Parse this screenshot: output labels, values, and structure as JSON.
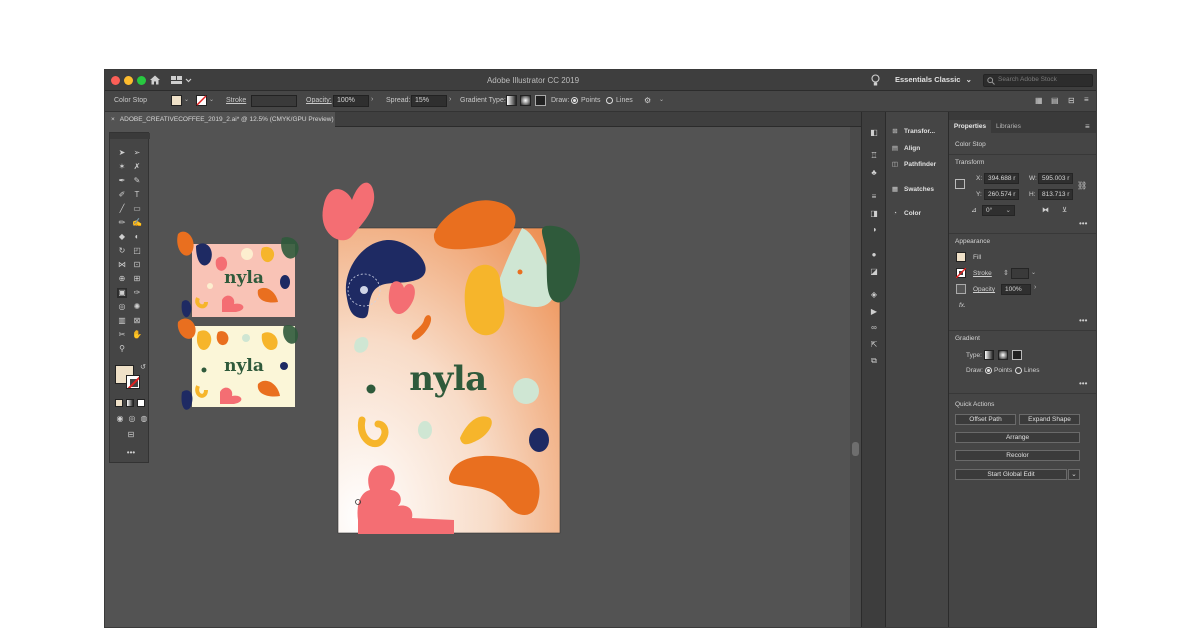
{
  "window": {
    "title": "Adobe Illustrator CC 2019",
    "workspace": "Essentials Classic",
    "search_placeholder": "Search Adobe Stock"
  },
  "control_bar": {
    "label": "Color Stop",
    "stroke_label": "Stroke",
    "opacity_label": "Opacity:",
    "opacity_value": "100%",
    "spread_label": "Spread:",
    "spread_value": "15%",
    "gradient_type_label": "Gradient Type:",
    "draw_label": "Draw:",
    "points_label": "Points",
    "lines_label": "Lines"
  },
  "document_tab": {
    "label": "ADOBE_CREATIVECOFFEE_2019_2.ai* @ 12.5% (CMYK/GPU Preview)"
  },
  "artboards": {
    "brand_text": "nyla"
  },
  "collapsed_panels": {
    "items": [
      "Transfor...",
      "Align",
      "Pathfinder",
      "Swatches",
      "Color"
    ]
  },
  "properties_panel": {
    "tabs": [
      "Properties",
      "Libraries"
    ],
    "selection": "Color Stop",
    "transform": {
      "title": "Transform",
      "x_label": "X:",
      "x_value": "394.688 r",
      "y_label": "Y:",
      "y_value": "260.574 r",
      "w_label": "W:",
      "w_value": "595.003 r",
      "h_label": "H:",
      "h_value": "813.713 r",
      "angle_value": "0°"
    },
    "appearance": {
      "title": "Appearance",
      "fill_label": "Fill",
      "stroke_label": "Stroke",
      "opacity_label": "Opacity",
      "opacity_value": "100%",
      "fx_label": "fx."
    },
    "gradient": {
      "title": "Gradient",
      "type_label": "Type:",
      "draw_label": "Draw:",
      "points_label": "Points",
      "lines_label": "Lines"
    },
    "quick_actions": {
      "title": "Quick Actions",
      "offset_path": "Offset Path",
      "expand_shape": "Expand Shape",
      "arrange": "Arrange",
      "recolor": "Recolor",
      "start_global_edit": "Start Global Edit"
    }
  },
  "colors": {
    "app_bg": "#535353",
    "panel_bg": "#454545",
    "brand_green": "#2f5a3b",
    "orange": "#e96f1f",
    "pink": "#f46e73",
    "navy": "#1e2a63",
    "yellow": "#f6b52b",
    "mint": "#cfe6d3"
  },
  "icons": [
    "home-icon",
    "layout-icon",
    "lightbulb-icon",
    "search-icon",
    "close-icon",
    "chevron-down-icon",
    "more-icon"
  ]
}
